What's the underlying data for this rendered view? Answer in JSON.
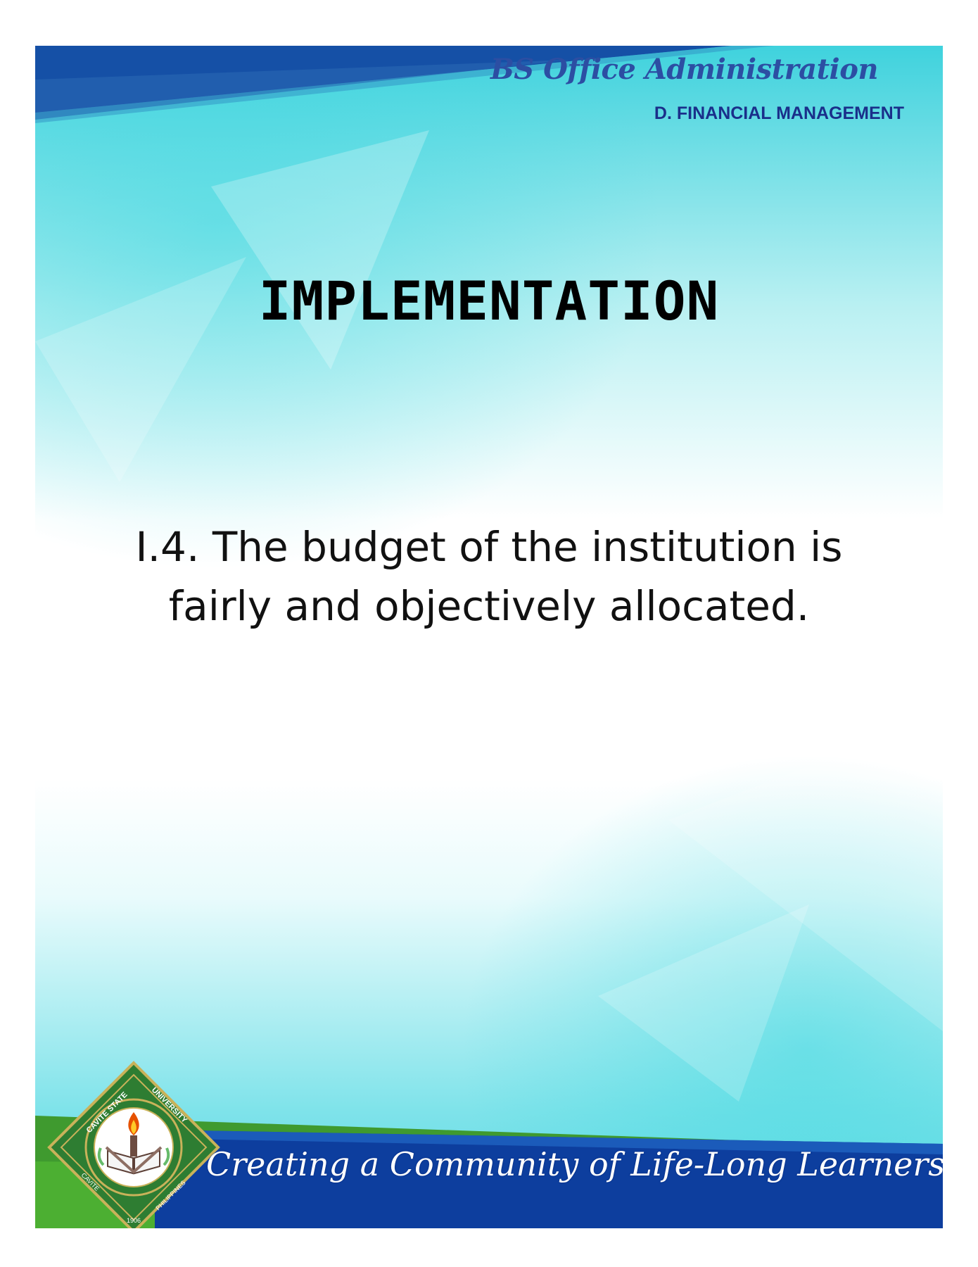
{
  "header": {
    "program_title": "BS Office Administration",
    "area_label": "D. FINANCIAL MANAGEMENT"
  },
  "main": {
    "section_heading": "IMPLEMENTATION",
    "statement_line1": "I.4. The budget of the institution is",
    "statement_line2": "fairly and objectively allocated."
  },
  "footer": {
    "tagline": "Creating a Community of Life-Long Learners",
    "seal": {
      "top_text": "CAVITE STATE UNIVERSITY",
      "bottom_left": "CAVITE",
      "bottom_right": "PHILIPPINES",
      "year": "1906"
    }
  },
  "colors": {
    "header_band": "#1550a6",
    "teal": "#3fd2dd",
    "footer_green": "#3f9a2f",
    "footer_blue": "#0d3e9e",
    "title_blue": "#2c4ea3"
  }
}
